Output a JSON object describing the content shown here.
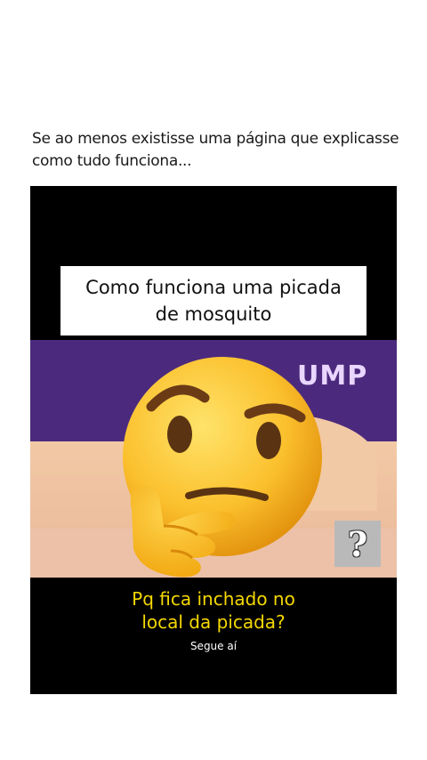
{
  "caption": {
    "line1": "Se ao menos existisse uma página que explicasse",
    "line2": "como tudo funciona..."
  },
  "media": {
    "title_line1": "Como funciona uma picada",
    "title_line2": "de mosquito",
    "background_text": "UMP",
    "question_mark": "?",
    "subtitle_line1": "Pq fica inchado no",
    "subtitle_line2": "local da picada?",
    "footer": "Segue aí"
  },
  "colors": {
    "purple_band": "#4b2a7d",
    "skin": "#f2c9a5",
    "subtitle": "#f5d800",
    "emoji_face": "#fbc02d"
  },
  "icons": {
    "thinking_face": "thinking-face-emoji-icon",
    "question": "question-mark-icon"
  }
}
